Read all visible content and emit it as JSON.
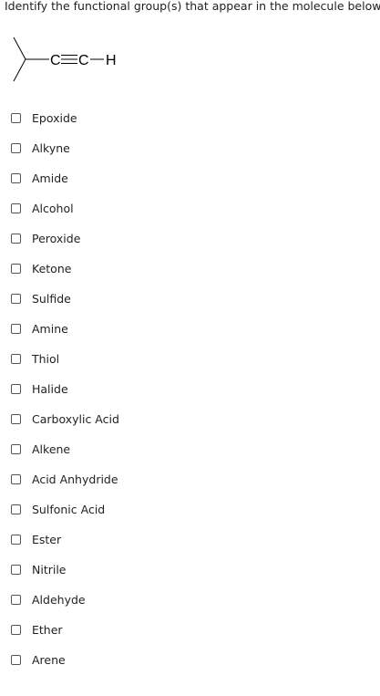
{
  "question": {
    "text": "Identify the functional group(s) that appear in the molecule below."
  },
  "molecule": {
    "atoms": [
      "C",
      "C",
      "H"
    ],
    "bonds": [
      "single",
      "triple",
      "single"
    ],
    "line_color": "#000000"
  },
  "options": [
    {
      "label": "Epoxide",
      "checked": false
    },
    {
      "label": "Alkyne",
      "checked": false
    },
    {
      "label": "Amide",
      "checked": false
    },
    {
      "label": "Alcohol",
      "checked": false
    },
    {
      "label": "Peroxide",
      "checked": false
    },
    {
      "label": "Ketone",
      "checked": false
    },
    {
      "label": "Sulfide",
      "checked": false
    },
    {
      "label": "Amine",
      "checked": false
    },
    {
      "label": "Thiol",
      "checked": false
    },
    {
      "label": "Halide",
      "checked": false
    },
    {
      "label": "Carboxylic Acid",
      "checked": false
    },
    {
      "label": "Alkene",
      "checked": false
    },
    {
      "label": "Acid Anhydride",
      "checked": false
    },
    {
      "label": "Sulfonic Acid",
      "checked": false
    },
    {
      "label": "Ester",
      "checked": false
    },
    {
      "label": "Nitrile",
      "checked": false
    },
    {
      "label": "Aldehyde",
      "checked": false
    },
    {
      "label": "Ether",
      "checked": false
    },
    {
      "label": "Arene",
      "checked": false
    }
  ]
}
